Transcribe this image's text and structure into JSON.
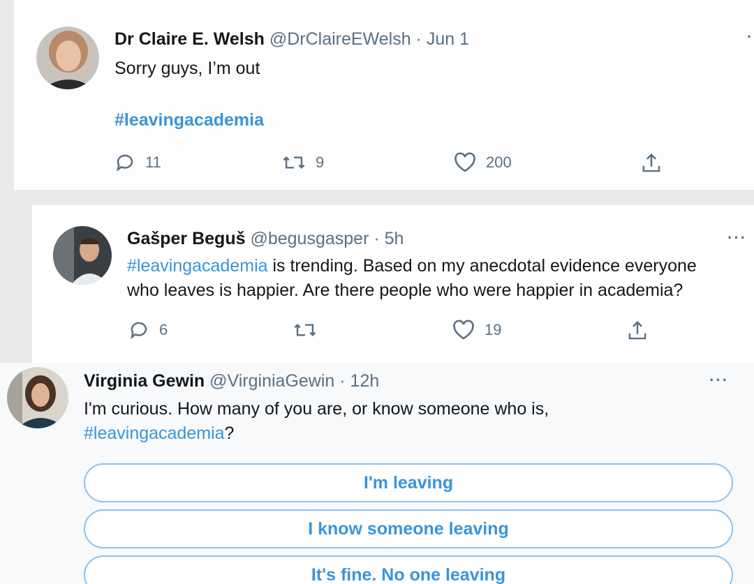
{
  "tweets": [
    {
      "display_name": "Dr Claire E. Welsh",
      "handle": "@DrClaireEWelsh",
      "time": "· Jun 1",
      "text": "Sorry guys, I’m out",
      "hashtag": "#leavingacademia",
      "replies": "11",
      "retweets": "9",
      "likes": "200"
    },
    {
      "display_name": "Gašper Beguš",
      "handle": "@begusgasper",
      "time": "· 5h",
      "hashtag": "#leavingacademia",
      "text_after_hashtag": " is trending. Based on my anecdotal evidence everyone",
      "text_line2": "who leaves is happier. Are there people who were happier in academia?",
      "replies": "6",
      "retweets": "",
      "likes": "19"
    },
    {
      "display_name": "Virginia Gewin",
      "handle": "@VirginiaGewin",
      "time": "· 12h",
      "text_line1": "I'm curious. How many of you are, or know someone who is,",
      "hashtag": "#leavingacademia",
      "text_after_hashtag": "?",
      "poll_options": [
        "I'm leaving",
        "I know someone leaving",
        "It's fine. No one leaving"
      ]
    }
  ],
  "icons": {
    "reply": "reply-icon",
    "retweet": "retweet-icon",
    "like": "heart-icon",
    "share": "share-icon",
    "more": "more-icon"
  },
  "colors": {
    "link": "#3b94d9",
    "meta": "#5b7083",
    "poll_border": "#8fc1ea"
  }
}
